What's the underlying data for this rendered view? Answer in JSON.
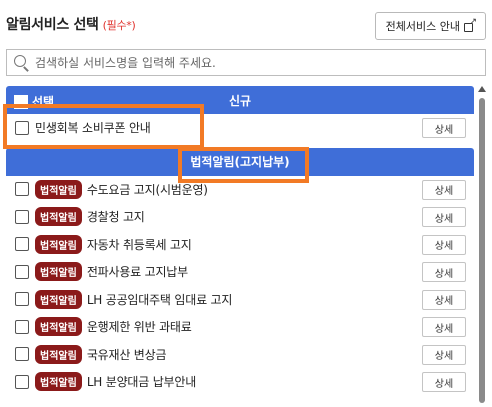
{
  "header": {
    "title": "알림서비스 선택",
    "required": "(필수*)",
    "all_services_label": "전체서비스 안내"
  },
  "search": {
    "placeholder": "검색하실 서비스명을 입력해 주세요."
  },
  "groups": [
    {
      "select_label": "선택",
      "title": "신규",
      "items": [
        {
          "label": "민생회복 소비쿠폰 안내",
          "detail": "상세"
        }
      ]
    },
    {
      "title": "법적알림(고지납부)",
      "badge": "법적알림",
      "items": [
        {
          "label": "수도요금 고지(시범운영)",
          "detail": "상세"
        },
        {
          "label": "경찰청 고지",
          "detail": "상세"
        },
        {
          "label": "자동차 취등록세 고지",
          "detail": "상세"
        },
        {
          "label": "전파사용료 고지납부",
          "detail": "상세"
        },
        {
          "label": "LH 공공임대주택 임대료 고지",
          "detail": "상세"
        },
        {
          "label": "운행제한 위반 과태료",
          "detail": "상세"
        },
        {
          "label": "국유재산 변상금",
          "detail": "상세"
        },
        {
          "label": "LH 분양대금 납부안내",
          "detail": "상세"
        }
      ]
    }
  ],
  "colors": {
    "header_blue": "#3f6ed8",
    "badge_red": "#8b1a1a",
    "highlight_orange": "#f27a25",
    "required_red": "#e0342f"
  }
}
